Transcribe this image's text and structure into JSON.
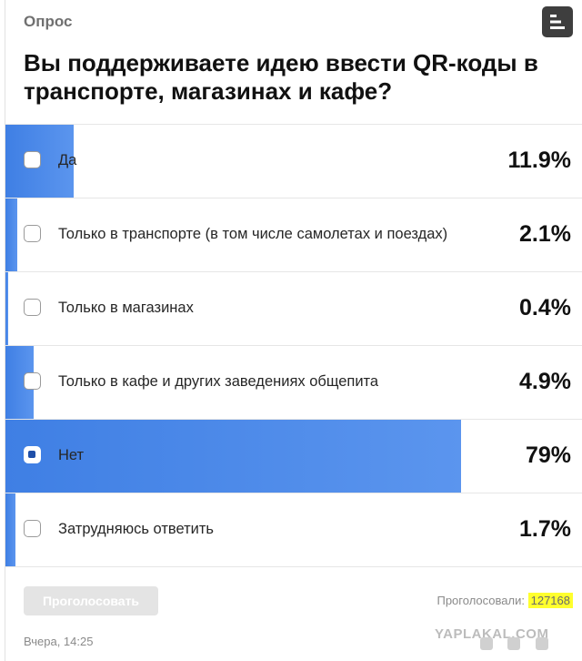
{
  "poll": {
    "header": "Опрос",
    "question": "Вы поддерживаете идею ввести QR-коды в транспорте, магазинах и кафе?",
    "options": [
      {
        "label": "Да",
        "percent_text": "11.9%",
        "percent": 11.9,
        "selected": false
      },
      {
        "label": "Только в транспорте (в том числе самолетах и поездах)",
        "percent_text": "2.1%",
        "percent": 2.1,
        "selected": false
      },
      {
        "label": "Только в магазинах",
        "percent_text": "0.4%",
        "percent": 0.4,
        "selected": false
      },
      {
        "label": "Только в кафе и других заведениях общепита",
        "percent_text": "4.9%",
        "percent": 4.9,
        "selected": false
      },
      {
        "label": "Нет",
        "percent_text": "79%",
        "percent": 79,
        "selected": true
      },
      {
        "label": "Затрудняюсь ответить",
        "percent_text": "1.7%",
        "percent": 1.7,
        "selected": false
      }
    ],
    "vote_button": "Проголосовать",
    "voted_label": "Проголосовали:",
    "voted_count": "127168",
    "timestamp": "Вчера, 14:25"
  },
  "watermark": "YAPLAKAL.COM",
  "icons": {
    "menu": "menu-bars-icon"
  },
  "colors": {
    "bar": "#4a86e8",
    "highlight": "#ffff2e",
    "menu_button": "#3e3e3e"
  }
}
